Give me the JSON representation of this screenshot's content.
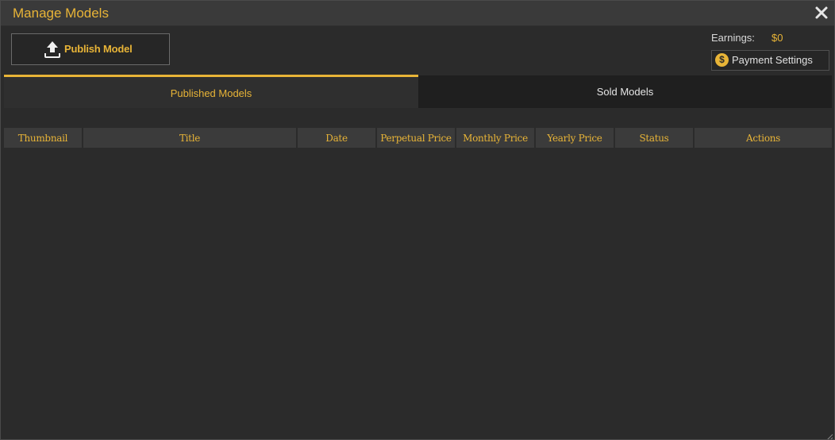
{
  "window": {
    "title": "Manage Models",
    "close_icon": "close-icon"
  },
  "toolbar": {
    "publish_label": "Publish Model",
    "publish_icon": "upload-icon",
    "earnings_label": "Earnings:",
    "earnings_value": "$0",
    "payment_label": "Payment Settings",
    "payment_icon": "dollar-coin-icon",
    "dollar_symbol": "$"
  },
  "tabs": [
    {
      "label": "Published Models",
      "active": true
    },
    {
      "label": "Sold Models",
      "active": false
    }
  ],
  "table": {
    "columns": [
      "Thumbnail",
      "Title",
      "Date",
      "Perpetual Price",
      "Monthly Price",
      "Yearly Price",
      "Status",
      "Actions"
    ],
    "rows": []
  },
  "colors": {
    "accent": "#e8b437",
    "background": "#2b2b2b",
    "titlebar": "#3a3a3a",
    "header_cell": "#3b3b3b",
    "inactive_tab": "#1f1f1f"
  }
}
